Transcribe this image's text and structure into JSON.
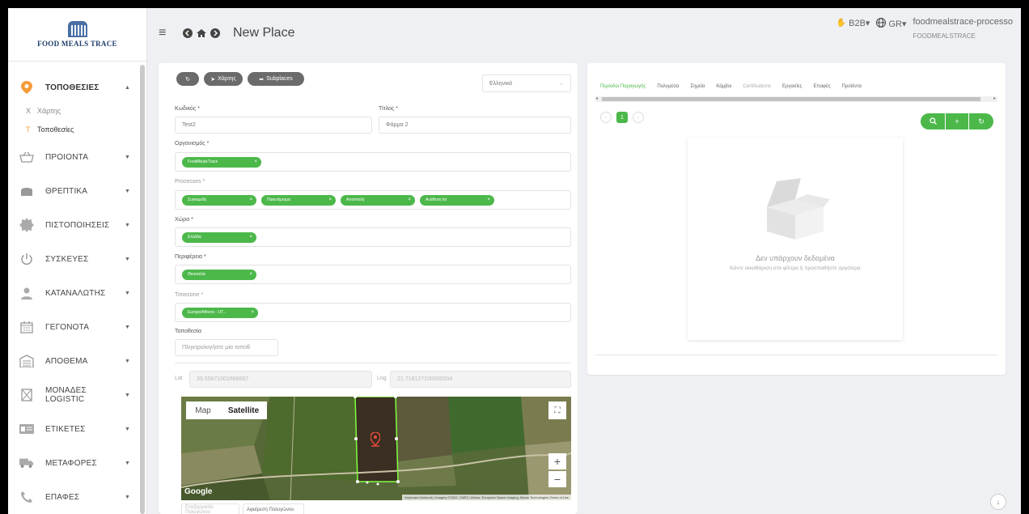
{
  "app": {
    "logo_text": "FOOD MEALS TRACE"
  },
  "topbar": {
    "title": "New Place",
    "b2b": "B2B▾",
    "lang": "GR▾",
    "user_name": "foodmealstrace-processo",
    "org_name": "FOODMEALSTRACE"
  },
  "sidebar": {
    "items": [
      {
        "label": "ΤΟΠΟΘΕΣΙΕΣ",
        "icon": "location-pin-icon",
        "caret": "▲"
      },
      {
        "label": "ΠΡΟΙΟΝΤΑ",
        "icon": "basket-icon",
        "caret": "▼"
      },
      {
        "label": "ΘΡΕΠΤΙΚΑ",
        "icon": "bread-icon",
        "caret": "▼"
      },
      {
        "label": "ΠΙΣΤΟΠΟΙΗΣΕΙΣ",
        "icon": "certificate-icon",
        "caret": "▼"
      },
      {
        "label": "ΣΥΣΚΕΥΕΣ",
        "icon": "power-icon",
        "caret": "▼"
      },
      {
        "label": "ΚΑΤΑΝΑΛΩΤΗΣ",
        "icon": "person-icon",
        "caret": "▼"
      },
      {
        "label": "ΓΕΓΟΝΟΤΑ",
        "icon": "calendar-icon",
        "caret": "▼"
      },
      {
        "label": "ΑΠΟΘΕΜΑ",
        "icon": "warehouse-icon",
        "caret": "▼"
      },
      {
        "label": "ΜΟΝΑΔΕΣ LOGISTIC",
        "icon": "box-icon",
        "caret": "▼"
      },
      {
        "label": "ΕΤΙΚΕΤΕΣ",
        "icon": "label-icon",
        "caret": "▼"
      },
      {
        "label": "ΜΕΤΑΦΟΡΕΣ",
        "icon": "truck-icon",
        "caret": "▼"
      },
      {
        "label": "ΕΠΑΦΕΣ",
        "icon": "phone-icon",
        "caret": "▼"
      }
    ],
    "subitems": [
      {
        "letter": "X",
        "label": "Χάρτης"
      },
      {
        "letter": "T",
        "label": "Τοποθεσίες"
      }
    ]
  },
  "form": {
    "btn_map": "Χάρτης",
    "btn_subplaces": "Subplaces",
    "language_select": "Ελληνικά",
    "code_label": "Κωδικός *",
    "code_value": "Test2",
    "title_label": "Τίτλος *",
    "title_value": "Φάρμα 2",
    "org_label": "Οργανισμός *",
    "org_chips": [
      "FoodMealsTrace"
    ],
    "processes_label": "Processes *",
    "processes_chips": [
      "Συγκομιδή",
      "Πακετάρισμα",
      "Αποστολή",
      "Ανάθεση lot"
    ],
    "country_label": "Χώρα *",
    "country_chips": [
      "Ελλάδα"
    ],
    "region_label": "Περιφέρεια *",
    "region_chips": [
      "Θεσσαλία"
    ],
    "timezone_label": "Timezone *",
    "timezone_chips": [
      "Europe/Athens - UT..."
    ],
    "location_label": "Τοποθεσία",
    "location_placeholder": "Πληκτρολογήστε μία τοποθ",
    "lat_label": "Lat",
    "lat_value": "39.55871001666667",
    "lng_label": "Lng",
    "lng_value": "21.718127100000004",
    "map_type_map": "Map",
    "map_type_satellite": "Satellite",
    "map_brand": "Google",
    "map_attribution": "Keyboard shortcuts | Imagery ©2022, CNES / Airbus, European Space Imaging, Maxar Technologies   Terms of Use",
    "zoom_in": "+",
    "zoom_out": "−",
    "btn_edit_polygon": "Επεξεργασία Πολυγώνου",
    "btn_remove_polygon": "Αφαίρεση Πολυγώνου"
  },
  "panel": {
    "tabs": [
      "Περίοδοι Παραγωγής",
      "Πολυμέσα",
      "Σημεία",
      "Κάμβοι",
      "Certifications",
      "Εργασίες",
      "Επαφές",
      "Προϊόντα"
    ],
    "active_tab": 0,
    "page": "1",
    "empty_title": "Δεν υπάρχουν δεδομένα",
    "empty_sub": "Κάντε εκκαθάριση στα φίλτρα ή προσπαθήστε αργότερα"
  },
  "colors": {
    "accent": "#4cb84a",
    "active_nav": "#f39c3b"
  }
}
